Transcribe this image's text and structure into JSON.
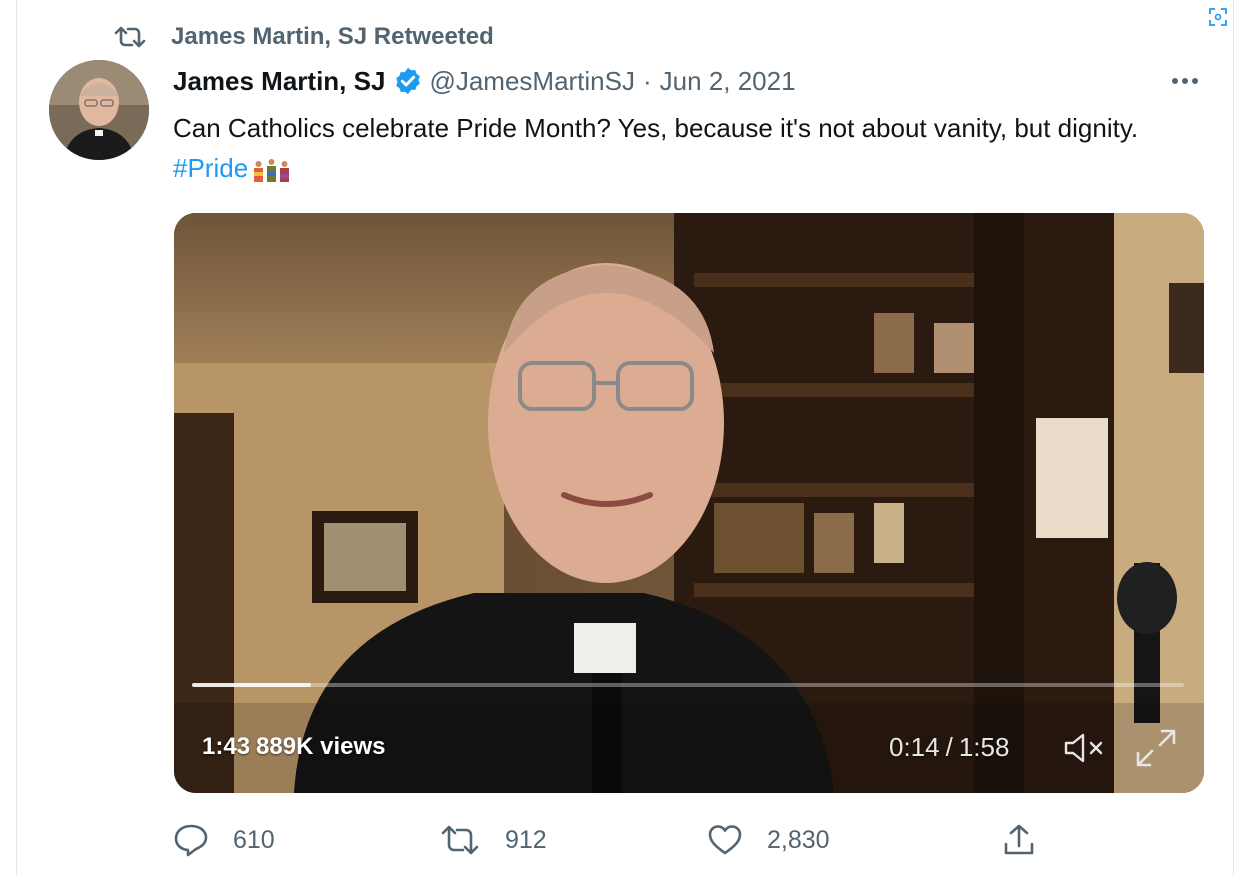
{
  "retweet_header": {
    "label": "James Martin, SJ Retweeted",
    "icon": "retweet-icon"
  },
  "author": {
    "name": "James Martin, SJ",
    "handle": "@JamesMartinSJ",
    "date": "Jun 2, 2021",
    "separator": "·",
    "verified": true
  },
  "tweet": {
    "text": "Can Catholics celebrate Pride Month? Yes, because it's not about vanity, but dignity.",
    "hashtag": "#Pride"
  },
  "video": {
    "elapsed_duration": "1:43",
    "views": "889K views",
    "current_time": "0:14",
    "total_time": "1:58",
    "time_divider": "/",
    "progress": 0.12
  },
  "actions": {
    "replies": "610",
    "retweets": "912",
    "likes": "2,830"
  },
  "colors": {
    "accent": "#1d9bf0",
    "secondary_text": "#536471",
    "primary_text": "#0f1419"
  }
}
